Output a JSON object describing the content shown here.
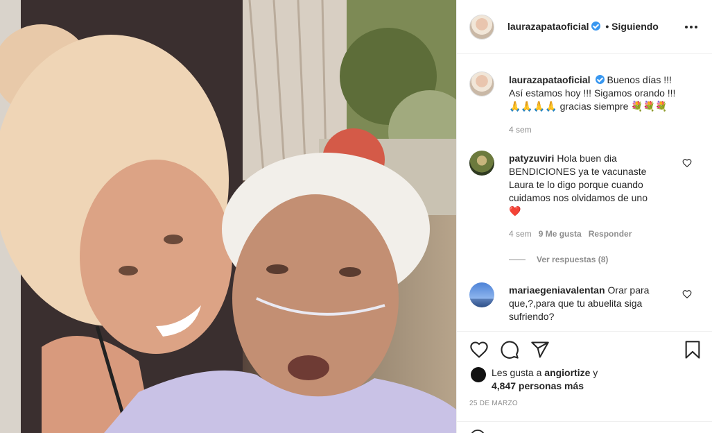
{
  "post": {
    "author": "laurazapataoficial",
    "follow_status": "• Siguiendo",
    "caption_lines": [
      "Buenos días !!!",
      "Así estamos hoy !!! Sigamos orando !!!",
      "🙏🙏🙏🙏 gracias siempre 💐💐💐"
    ],
    "caption_time": "4 sem"
  },
  "comments": [
    {
      "user": "patyzuviri",
      "lines": [
        "Hola buen dia",
        "BENDICIONES ya te vacunaste",
        "Laura te lo digo porque cuando",
        "cuidamos nos olvidamos de uno",
        "❤️"
      ],
      "time": "4 sem",
      "likes": "9 Me gusta",
      "reply": "Responder",
      "view_replies": "Ver respuestas (8)"
    },
    {
      "user": "mariaegeniavalentan",
      "lines": [
        "Orar para",
        "que,?,para que tu abuelita siga",
        "sufriendo?"
      ]
    }
  ],
  "likes": {
    "prefix": "Les gusta a",
    "user": "angiortize",
    "suffix": "y",
    "count_line": "4,847 personas más"
  },
  "date": "25 DE MARZO",
  "icons": [
    "more-icon",
    "heart-icon",
    "comment-icon",
    "share-icon",
    "bookmark-icon"
  ],
  "colors": {
    "verified": "#3897f0",
    "heart_red": "#ed4956",
    "muted": "#8e8e8e"
  }
}
